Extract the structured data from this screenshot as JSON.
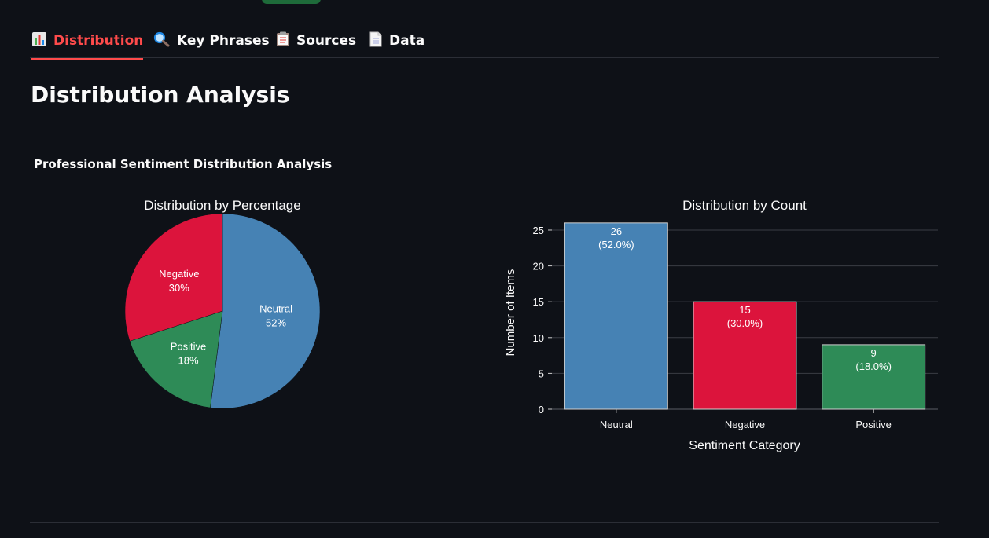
{
  "tabs": [
    {
      "label": "Distribution",
      "icon": "bar-chart-icon",
      "active": true
    },
    {
      "label": "Key Phrases",
      "icon": "magnifier-icon",
      "active": false
    },
    {
      "label": "Sources",
      "icon": "clipboard-icon",
      "active": false
    },
    {
      "label": "Data",
      "icon": "document-icon",
      "active": false
    }
  ],
  "page_title": "Distribution Analysis",
  "figure_title": "Professional Sentiment Distribution Analysis",
  "colors": {
    "Neutral": "#4682b4",
    "Negative": "#dc143c",
    "Positive": "#2e8b57",
    "active_tab": "#ff4b4b",
    "background": "#0e1117"
  },
  "chart_data": [
    {
      "type": "pie",
      "title": "Distribution by Percentage",
      "slices": [
        {
          "label": "Neutral",
          "value": 52,
          "text": "52%"
        },
        {
          "label": "Positive",
          "value": 18,
          "text": "18%"
        },
        {
          "label": "Negative",
          "value": 30,
          "text": "30%"
        }
      ],
      "start_angle_deg": 90,
      "direction": "clockwise"
    },
    {
      "type": "bar",
      "title": "Distribution by Count",
      "categories": [
        "Neutral",
        "Negative",
        "Positive"
      ],
      "values": [
        26,
        15,
        9
      ],
      "value_labels": [
        [
          "26",
          "(52.0%)"
        ],
        [
          "15",
          "(30.0%)"
        ],
        [
          "9",
          "(18.0%)"
        ]
      ],
      "xlabel": "Sentiment Category",
      "ylabel": "Number of Items",
      "ylim": [
        0,
        27.3
      ],
      "yticks": [
        0,
        5,
        10,
        15,
        20,
        25
      ],
      "grid": true
    }
  ]
}
